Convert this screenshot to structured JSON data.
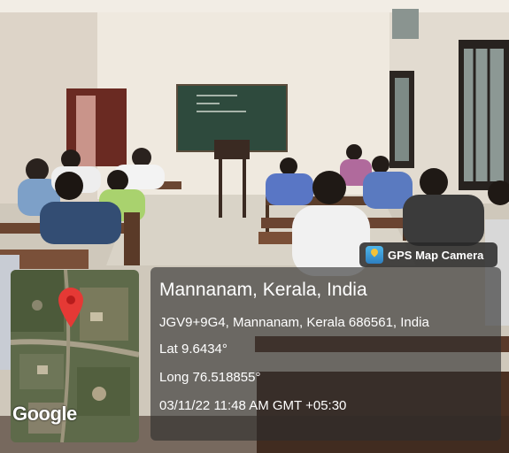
{
  "watermark": {
    "app_name": "GPS Map Camera",
    "app_icon": "gps-map-camera-app-icon",
    "location_title": "Mannanam, Kerala, India",
    "address": "JGV9+9G4, Mannanam, Kerala 686561, India",
    "latitude": "Lat 9.6434°",
    "longitude": "Long 76.518855°",
    "datetime": "03/11/22 11:48 AM GMT +05:30",
    "map_logo": "Google",
    "map_pin_icon": "map-pin-icon"
  },
  "colors": {
    "wall": "#ece6dc",
    "blackboard": "#2f4a3e",
    "floor": "#d8d2c6",
    "overlay": "#2d2d2d",
    "pin": "#e53935"
  }
}
